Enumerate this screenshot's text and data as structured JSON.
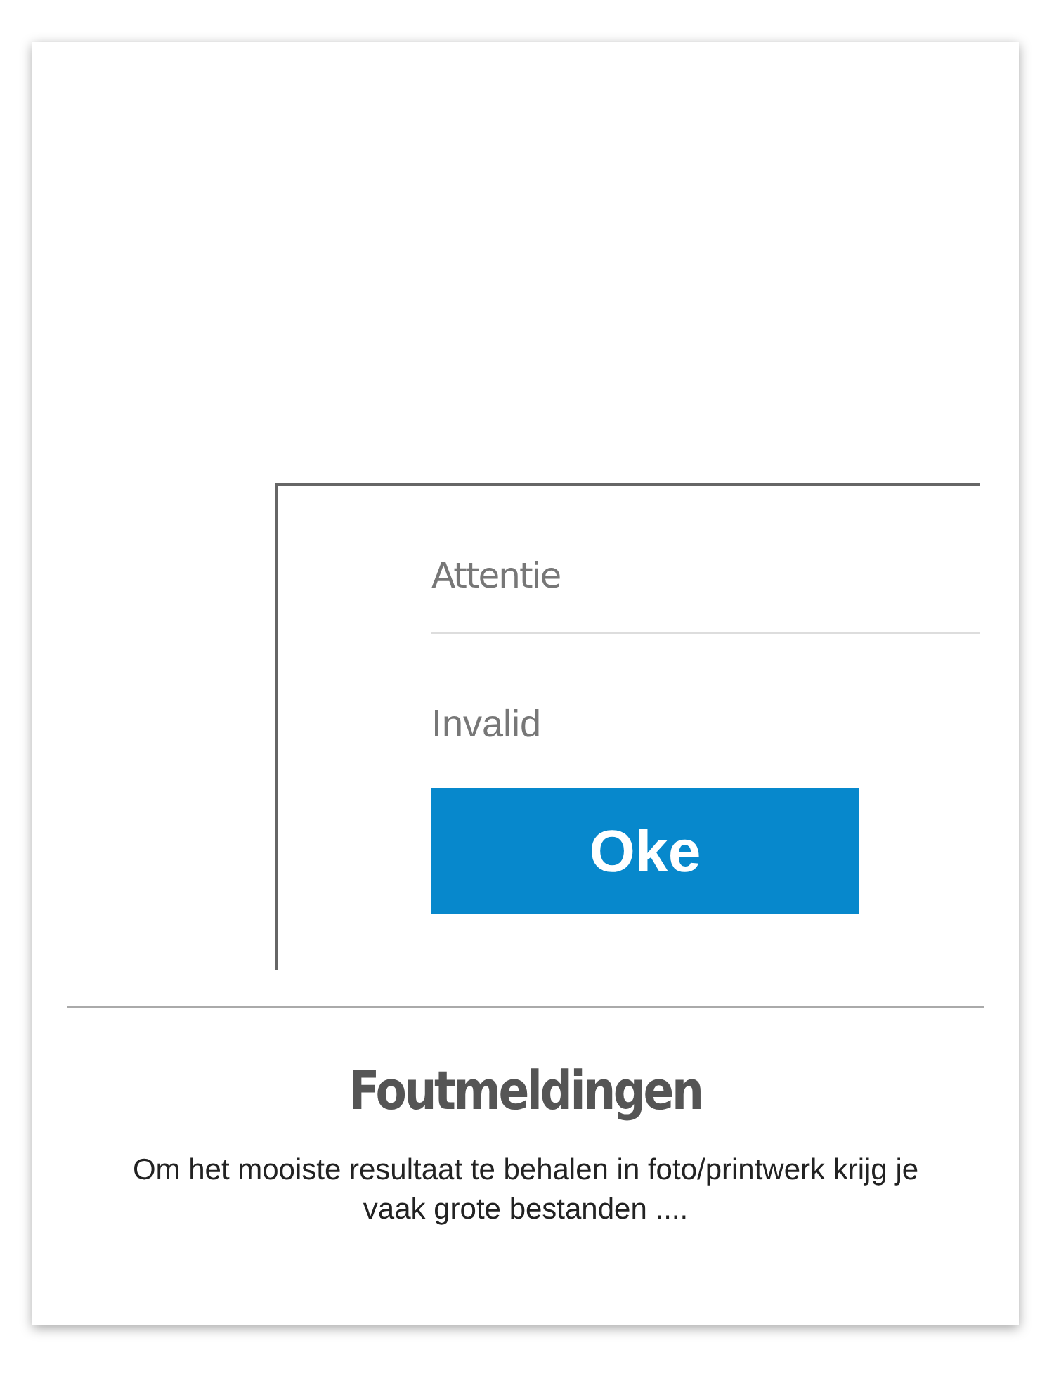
{
  "dialog": {
    "title": "Attentie",
    "message": "Invalid",
    "button": "Oke"
  },
  "card": {
    "title": "Foutmeldingen",
    "description": "Om het mooiste resultaat te behalen in foto/printwerk krijg je vaak grote bestanden ...."
  }
}
